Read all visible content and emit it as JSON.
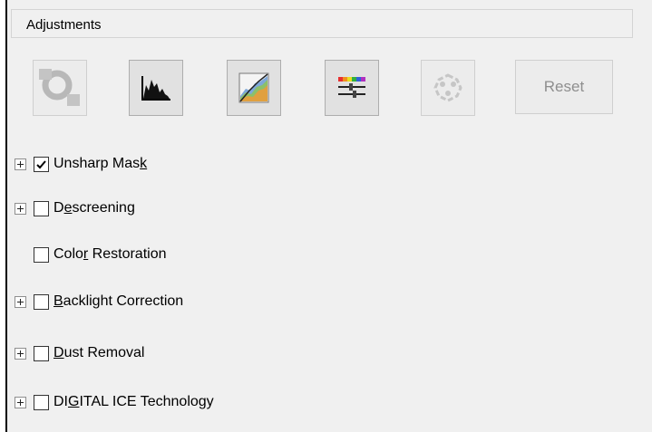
{
  "header": {
    "title": "Adjustments"
  },
  "toolbar": {
    "buttons": [
      {
        "icon": "auto-exposure-icon",
        "enabled": false
      },
      {
        "icon": "histogram-icon",
        "enabled": true
      },
      {
        "icon": "tone-curve-icon",
        "enabled": true
      },
      {
        "icon": "color-palette-icon",
        "enabled": true
      },
      {
        "icon": "image-adjustment-icon",
        "enabled": false
      }
    ],
    "reset_label": "Reset"
  },
  "options": [
    {
      "pre": "Unsharp Mas",
      "key": "k",
      "post": "",
      "checked": true,
      "expandable": true
    },
    {
      "pre": "D",
      "key": "e",
      "post": "screening",
      "checked": false,
      "expandable": true
    },
    {
      "pre": "Colo",
      "key": "r",
      "post": " Restoration",
      "checked": false,
      "expandable": false
    },
    {
      "pre": "",
      "key": "B",
      "post": "acklight Correction",
      "checked": false,
      "expandable": true
    },
    {
      "pre": "",
      "key": "D",
      "post": "ust Removal",
      "checked": false,
      "expandable": true
    },
    {
      "pre": "DI",
      "key": "G",
      "post": "ITAL ICE Technology",
      "checked": false,
      "expandable": true
    }
  ]
}
